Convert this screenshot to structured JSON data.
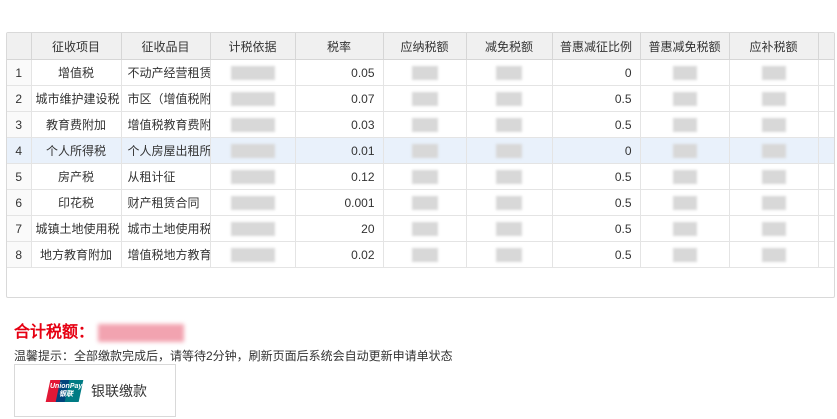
{
  "table": {
    "headers": [
      "",
      "征收项目",
      "征收品目",
      "计税依据",
      "税率",
      "应纳税额",
      "减免税额",
      "普惠减征比例",
      "普惠减免税额",
      "应补税额",
      ""
    ],
    "rows": [
      {
        "num": "1",
        "item": "增值税",
        "subitem": "不动产经营租赁",
        "basis": "",
        "rate": "0.05",
        "due": "",
        "relief": "",
        "ratio": "0",
        "benefit": "",
        "pay": ""
      },
      {
        "num": "2",
        "item": "城市维护建设税",
        "subitem": "市区（增值税附",
        "basis": "",
        "rate": "0.07",
        "due": "",
        "relief": "",
        "ratio": "0.5",
        "benefit": "",
        "pay": ""
      },
      {
        "num": "3",
        "item": "教育费附加",
        "subitem": "增值税教育费附",
        "basis": "",
        "rate": "0.03",
        "due": "",
        "relief": "",
        "ratio": "0.5",
        "benefit": "",
        "pay": ""
      },
      {
        "num": "4",
        "item": "个人所得税",
        "subitem": "个人房屋出租所",
        "basis": "",
        "rate": "0.01",
        "due": "",
        "relief": "",
        "ratio": "0",
        "benefit": "",
        "pay": ""
      },
      {
        "num": "5",
        "item": "房产税",
        "subitem": "从租计征",
        "basis": "",
        "rate": "0.12",
        "due": "",
        "relief": "",
        "ratio": "0.5",
        "benefit": "",
        "pay": ""
      },
      {
        "num": "6",
        "item": "印花税",
        "subitem": "财产租赁合同",
        "basis": "",
        "rate": "0.001",
        "due": "",
        "relief": "",
        "ratio": "0.5",
        "benefit": "",
        "pay": ""
      },
      {
        "num": "7",
        "item": "城镇土地使用税",
        "subitem": "城市土地使用税",
        "basis": "",
        "rate": "20",
        "due": "",
        "relief": "",
        "ratio": "0.5",
        "benefit": "",
        "pay": ""
      },
      {
        "num": "8",
        "item": "地方教育附加",
        "subitem": "增值税地方教育",
        "basis": "",
        "rate": "0.02",
        "due": "",
        "relief": "",
        "ratio": "0.5",
        "benefit": "",
        "pay": ""
      }
    ]
  },
  "total": {
    "label": "合计税额：",
    "value": ""
  },
  "notice": "温馨提示：全部缴款完成后，请等待2分钟，刷新页面后系统会自动更新申请单状态",
  "pay_button": {
    "label": "银联缴款",
    "icon": "unionpay-icon",
    "icon_text": "UnionPay 银联"
  },
  "colors": {
    "total_label": "#e60012",
    "header_bg": "#f0f0f0",
    "selected_row": "#e9f1fb",
    "unionpay_red": "#e21836",
    "unionpay_blue": "#00447c",
    "unionpay_teal": "#007b84"
  }
}
